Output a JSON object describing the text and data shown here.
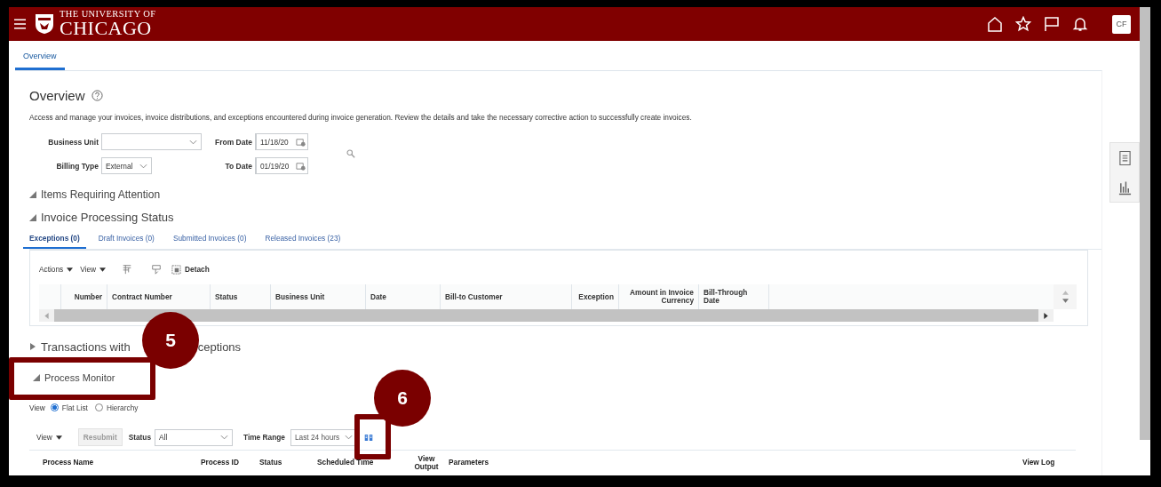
{
  "header": {
    "logo_top": "THE UNIVERSITY OF",
    "logo_bottom": "CHICAGO",
    "avatar": "CF"
  },
  "tabs": [
    {
      "label": "Overview",
      "selected": true
    }
  ],
  "page": {
    "title": "Overview",
    "description": "Access and manage your invoices, invoice distributions, and exceptions encountered during invoice generation. Review the details and take the necessary corrective action to successfully create invoices."
  },
  "filters": [
    {
      "label": "Business Unit",
      "kind": "select"
    },
    {
      "label": "From Date",
      "kind": "date",
      "value": "11/18/20"
    },
    {
      "label": "Billing Type",
      "kind": "select",
      "value": "External"
    },
    {
      "label": "To Date",
      "kind": "date",
      "value": "01/19/20"
    }
  ],
  "sections": [
    {
      "title": "Items Requiring Attention",
      "expanded": true
    },
    {
      "title": "Invoice Processing Status",
      "expanded": true
    }
  ],
  "status_tabs": [
    {
      "label": "Exceptions (0)",
      "selected": true
    },
    {
      "label": "Draft Invoices (0)",
      "selected": false
    },
    {
      "label": "Submitted Invoices (0)",
      "selected": false
    },
    {
      "label": "Released Invoices (23)",
      "selected": false
    }
  ],
  "invoice_table": {
    "toolbar": [
      "Actions",
      "View"
    ],
    "detach": "Detach",
    "columns": [
      "Number",
      "Contract Number",
      "Status",
      "Business Unit",
      "Date",
      "Bill-to Customer",
      "Exception",
      "Amount in Invoice Currency",
      "Bill-Through Date"
    ]
  },
  "transactions_section": {
    "title_start": "Transactions with",
    "title_end": "ceptions",
    "expanded": false
  },
  "process_section": {
    "title": "Process Monitor",
    "expanded": true
  },
  "view_options": {
    "label": "View",
    "options": [
      {
        "label": "Flat List",
        "selected": true
      },
      {
        "label": "Hierarchy",
        "selected": false
      }
    ]
  },
  "process_toolbar": {
    "view": "View",
    "resubmit": {
      "label": "Resubmit",
      "disabled": true
    },
    "status_label": "Status",
    "status_value": "All",
    "time_label": "Time Range",
    "time_value": "Last 24 hours"
  },
  "process_table": {
    "columns": [
      "Process Name",
      "Process ID",
      "Status",
      "Scheduled Time",
      "View Output",
      "Parameters",
      "View Log"
    ]
  },
  "callouts": [
    {
      "label": "5"
    },
    {
      "label": "6"
    }
  ]
}
